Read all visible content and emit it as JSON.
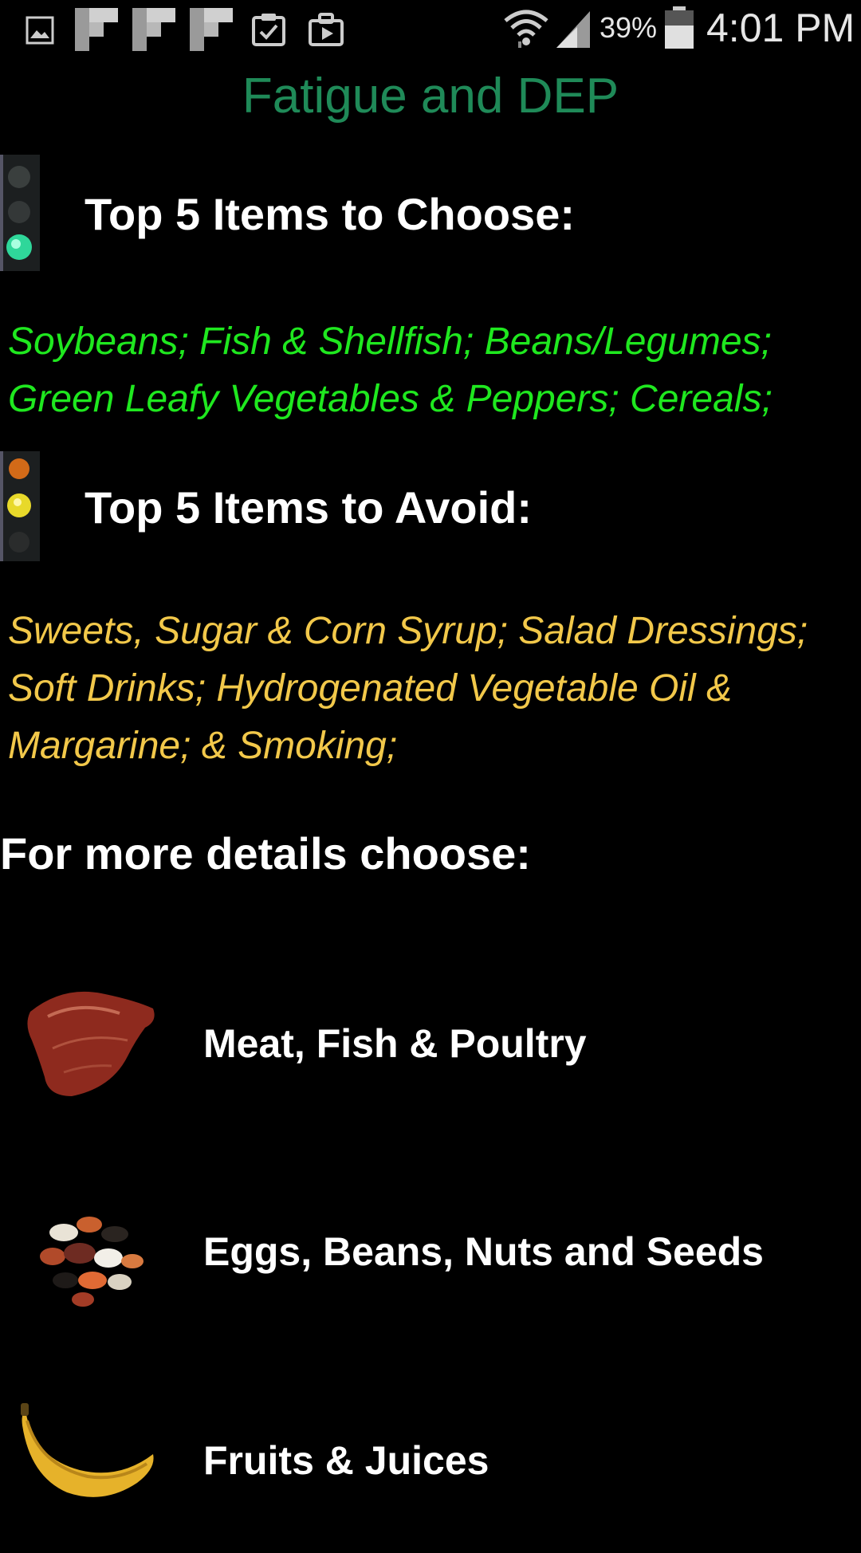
{
  "status_bar": {
    "icons": [
      "gallery-icon",
      "flipboard-icon",
      "flipboard-icon",
      "flipboard-icon",
      "clipboard-check-icon",
      "briefcase-icon",
      "wifi-icon",
      "cell-signal-icon",
      "battery-icon"
    ],
    "battery_percent": "39%",
    "time": "4:01 PM"
  },
  "page": {
    "title": "Fatigue and DEP",
    "title_color": "#1f8a58"
  },
  "choose_section": {
    "heading": "Top 5 Items to Choose:",
    "icon": "green-traffic-light-icon",
    "items_line1": "Soybeans; Fish & Shellfish; Beans/Legumes;",
    "items_line2": "Green Leafy Vegetables & Peppers; Cereals;",
    "color": "#1fe81f"
  },
  "avoid_section": {
    "heading": "Top 5 Items to Avoid:",
    "icon": "yellow-traffic-light-icon",
    "items_line1": "Sweets, Sugar & Corn Syrup; Salad Dressings;",
    "items_line2": "Soft Drinks; Hydrogenated Vegetable Oil &",
    "items_line3": "Margarine; & Smoking;",
    "color": "#f2c84a"
  },
  "details": {
    "heading": "For more details choose:",
    "categories": [
      {
        "label": "Meat, Fish & Poultry",
        "icon": "steak-icon"
      },
      {
        "label": "Eggs, Beans, Nuts and Seeds",
        "icon": "beans-icon"
      },
      {
        "label": "Fruits & Juices",
        "icon": "banana-icon"
      }
    ]
  }
}
